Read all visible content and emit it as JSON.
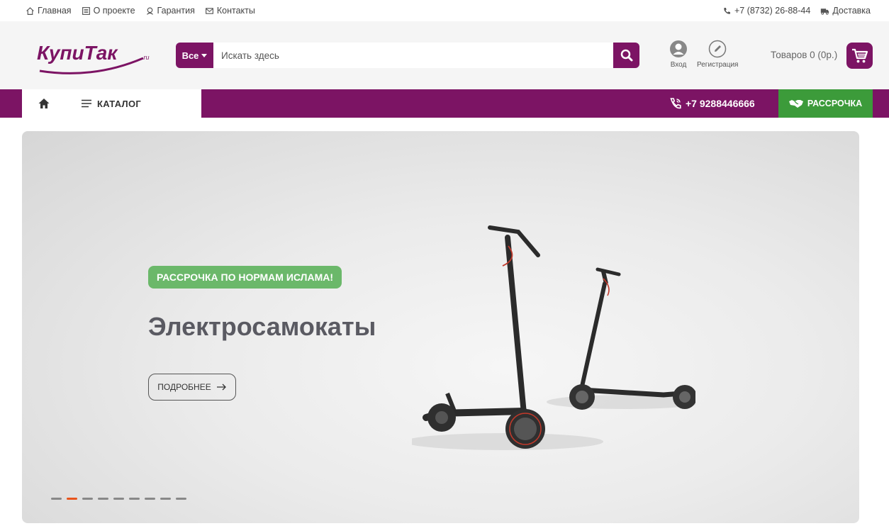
{
  "topbar": {
    "links": [
      {
        "label": "Главная",
        "icon": "home-icon"
      },
      {
        "label": "О проекте",
        "icon": "document-icon"
      },
      {
        "label": "Гарантия",
        "icon": "warranty-icon"
      },
      {
        "label": "Контакты",
        "icon": "mail-icon"
      }
    ],
    "phone": "+7 (8732) 26-88-44",
    "delivery": "Доставка"
  },
  "header": {
    "logo_text": "КупиТак.ru",
    "search": {
      "category": "Все",
      "placeholder": "Искать здесь"
    },
    "login": "Вход",
    "register": "Регистрация",
    "cart": "Товаров 0 (0р.)"
  },
  "nav": {
    "catalog": "КАТАЛОГ",
    "phone": "+7 9288446666",
    "installment": "РАССРОЧКА"
  },
  "banner": {
    "badge": "РАССРОЧКА ПО НОРМАМ ИСЛАМА!",
    "title": "Электросамокаты",
    "button": "ПОДРОБНЕЕ",
    "slides_total": 9,
    "active_slide": 2
  },
  "colors": {
    "brand": "#7c1464",
    "green": "#3c9b3a",
    "badge_green": "#6bb86a",
    "accent_dot": "#e8541c"
  }
}
